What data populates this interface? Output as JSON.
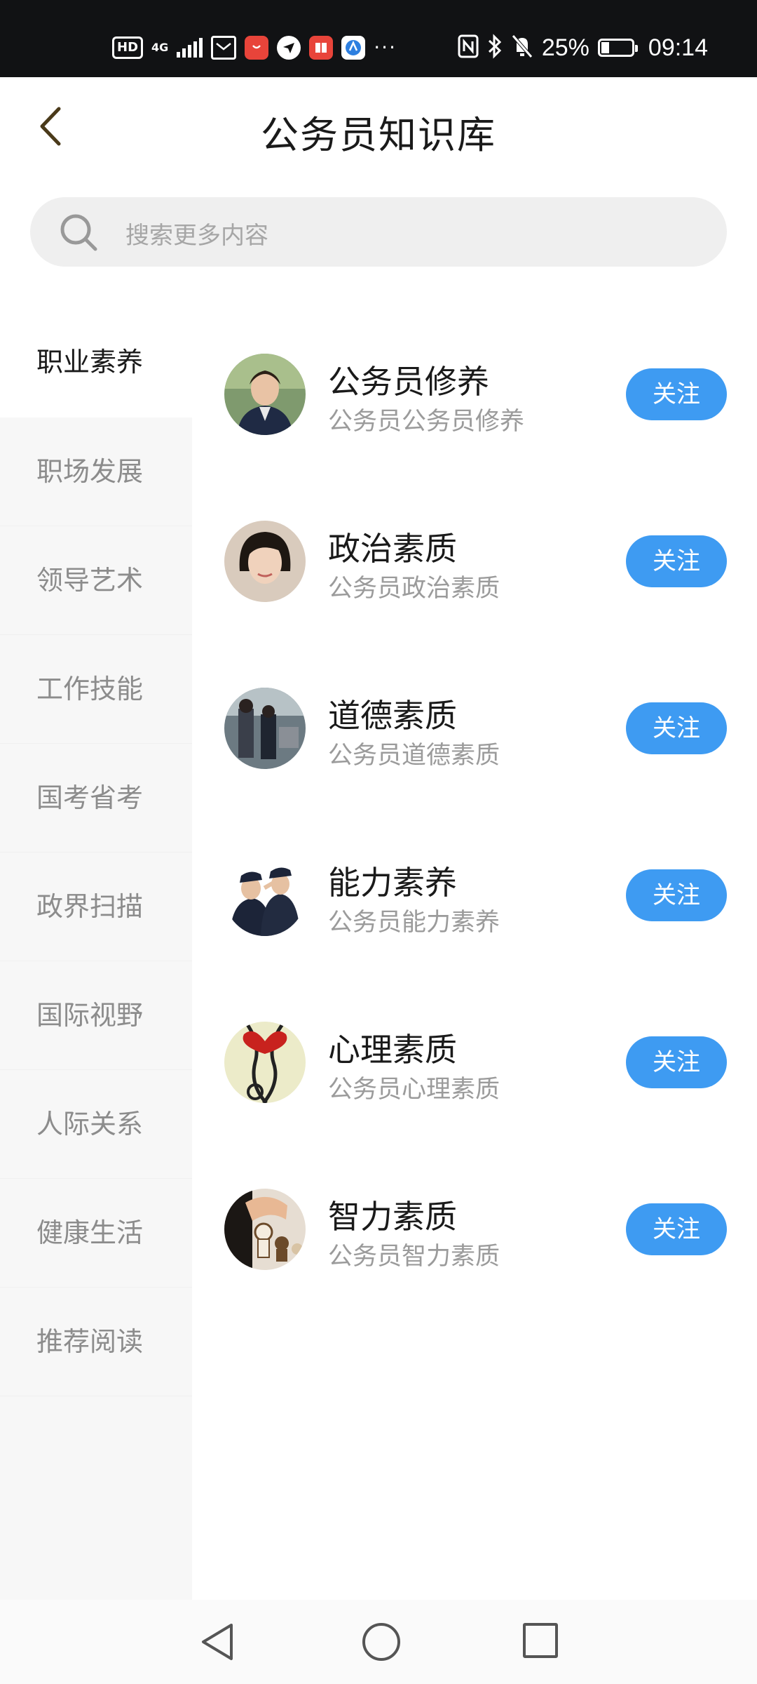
{
  "status_bar": {
    "hd": "HD",
    "network": "4G",
    "battery_percent": "25%",
    "time": "09:14",
    "more": "···",
    "app_icons": [
      "mail-icon",
      "huawei-store-icon",
      "paper-plane-icon",
      "red-book-icon",
      "browser-icon"
    ],
    "status_icons": [
      "nfc-icon",
      "bluetooth-icon",
      "bell-muted-icon",
      "battery-charging-icon"
    ]
  },
  "header": {
    "title": "公务员知识库"
  },
  "search": {
    "placeholder": "搜索更多内容"
  },
  "sidebar": {
    "items": [
      {
        "label": "职业素养",
        "active": true
      },
      {
        "label": "职场发展"
      },
      {
        "label": "领导艺术"
      },
      {
        "label": "工作技能"
      },
      {
        "label": "国考省考"
      },
      {
        "label": "政界扫描"
      },
      {
        "label": "国际视野"
      },
      {
        "label": "人际关系"
      },
      {
        "label": "健康生活"
      },
      {
        "label": "推荐阅读"
      }
    ]
  },
  "list": {
    "items": [
      {
        "title": "公务员修养",
        "subtitle": "公务员公务员修养",
        "button": "关注"
      },
      {
        "title": "政治素质",
        "subtitle": "公务员政治素质",
        "button": "关注"
      },
      {
        "title": "道德素质",
        "subtitle": "公务员道德素质",
        "button": "关注"
      },
      {
        "title": "能力素养",
        "subtitle": "公务员能力素养",
        "button": "关注"
      },
      {
        "title": "心理素质",
        "subtitle": "公务员心理素质",
        "button": "关注"
      },
      {
        "title": "智力素质",
        "subtitle": "公务员智力素质",
        "button": "关注"
      }
    ]
  },
  "colors": {
    "accent": "#3e9bf2",
    "sidebar_bg": "#f7f7f7",
    "status_bar_bg": "#111214"
  }
}
